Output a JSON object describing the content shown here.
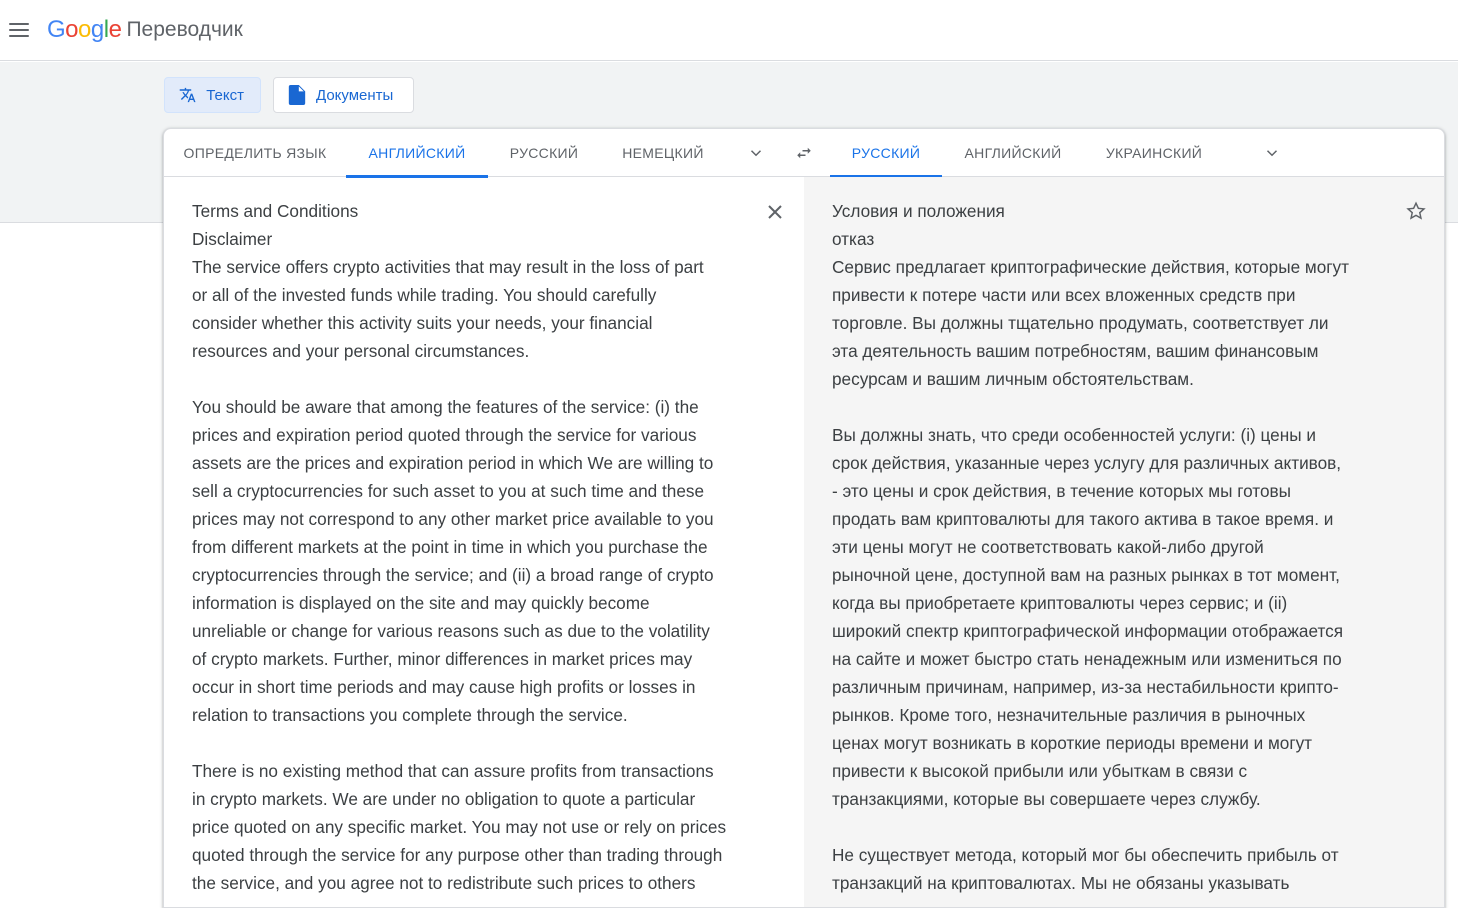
{
  "header": {
    "logo": [
      "G",
      "o",
      "o",
      "g",
      "l",
      "e"
    ],
    "product_name": "Переводчик"
  },
  "modes": {
    "text_label": "Текст",
    "documents_label": "Документы"
  },
  "source_languages": {
    "tabs": [
      "ОПРЕДЕЛИТЬ ЯЗЫК",
      "АНГЛИЙСКИЙ",
      "РУССКИЙ",
      "НЕМЕЦКИЙ"
    ],
    "active": "АНГЛИЙСКИЙ"
  },
  "target_languages": {
    "tabs": [
      "РУССКИЙ",
      "АНГЛИЙСКИЙ",
      "УКРАИНСКИЙ"
    ],
    "active": "РУССКИЙ"
  },
  "source_text": "Terms and Conditions\nDisclaimer\nThe service offers crypto activities that may result in the loss of part\nor all of the invested funds while trading. You should carefully\nconsider whether this activity suits your needs, your financial\nresources and your personal circumstances.\n\nYou should be aware that among the features of the service: (i) the\nprices and expiration period quoted through the service for various\nassets are the prices and expiration period in which We are willing to\nsell a cryptocurrencies for such asset to you at such time and these\nprices may not correspond to any other market price available to you\nfrom different markets at the point in time in which you purchase the\ncryptocurrencies through the service; and (ii) a broad range of crypto\ninformation is displayed on the site and may quickly become\nunreliable or change for various reasons such as due to the volatility\nof crypto markets. Further, minor differences in market prices may\noccur in short time periods and may cause high profits or losses in\nrelation to transactions you complete through the service.\n\nThere is no existing method that can assure profits from transactions\nin crypto markets. We are under no obligation to quote a particular\nprice quoted on any specific market. You may not use or rely on prices\nquoted through the service for any purpose other than trading through\nthe service, and you agree not to redistribute such prices to others",
  "translated_text": "Условия и положения\nотказ\nСервис предлагает криптографические действия, которые могут\nпривести к потере части или всех вложенных средств при\nторговле. Вы должны тщательно продумать, соответствует ли\nэта деятельность вашим потребностям, вашим финансовым\nресурсам и вашим личным обстоятельствам.\n\nВы должны знать, что среди особенностей услуги: (i) цены и\nсрок действия, указанные через услугу для различных активов,\n- это цены и срок действия, в течение которых мы готовы\nпродать вам криптовалюты для такого актива в такое время. и\nэти цены могут не соответствовать какой-либо другой\nрыночной цене, доступной вам на разных рынках в тот момент,\nкогда вы приобретаете криптовалюты через сервис; и (ii)\nширокий спектр криптографической информации отображается\nна сайте и может быстро стать ненадежным или измениться по\nразличным причинам, например, из-за нестабильности крипто-\nрынков. Кроме того, незначительные различия в рыночных\nценах могут возникать в короткие периоды времени и могут\nпривести к высокой прибыли или убыткам в связи с\nтранзакциями, которые вы совершаете через службу.\n\nНе существует метода, который мог бы обеспечить прибыль от\nтранзакций на криптовалютах. Мы не обязаны указывать",
  "icons": {
    "menu": "menu-icon",
    "translate": "translate-icon",
    "document": "document-icon",
    "chevron": "chevron-down-icon",
    "swap": "swap-icon",
    "clear": "close-icon",
    "star": "star-icon"
  },
  "colors": {
    "accent": "#1a73e8",
    "active_mode_bg": "#e2ebfa",
    "band_bg": "#f1f3f4",
    "target_pane_bg": "#f5f5f5"
  }
}
